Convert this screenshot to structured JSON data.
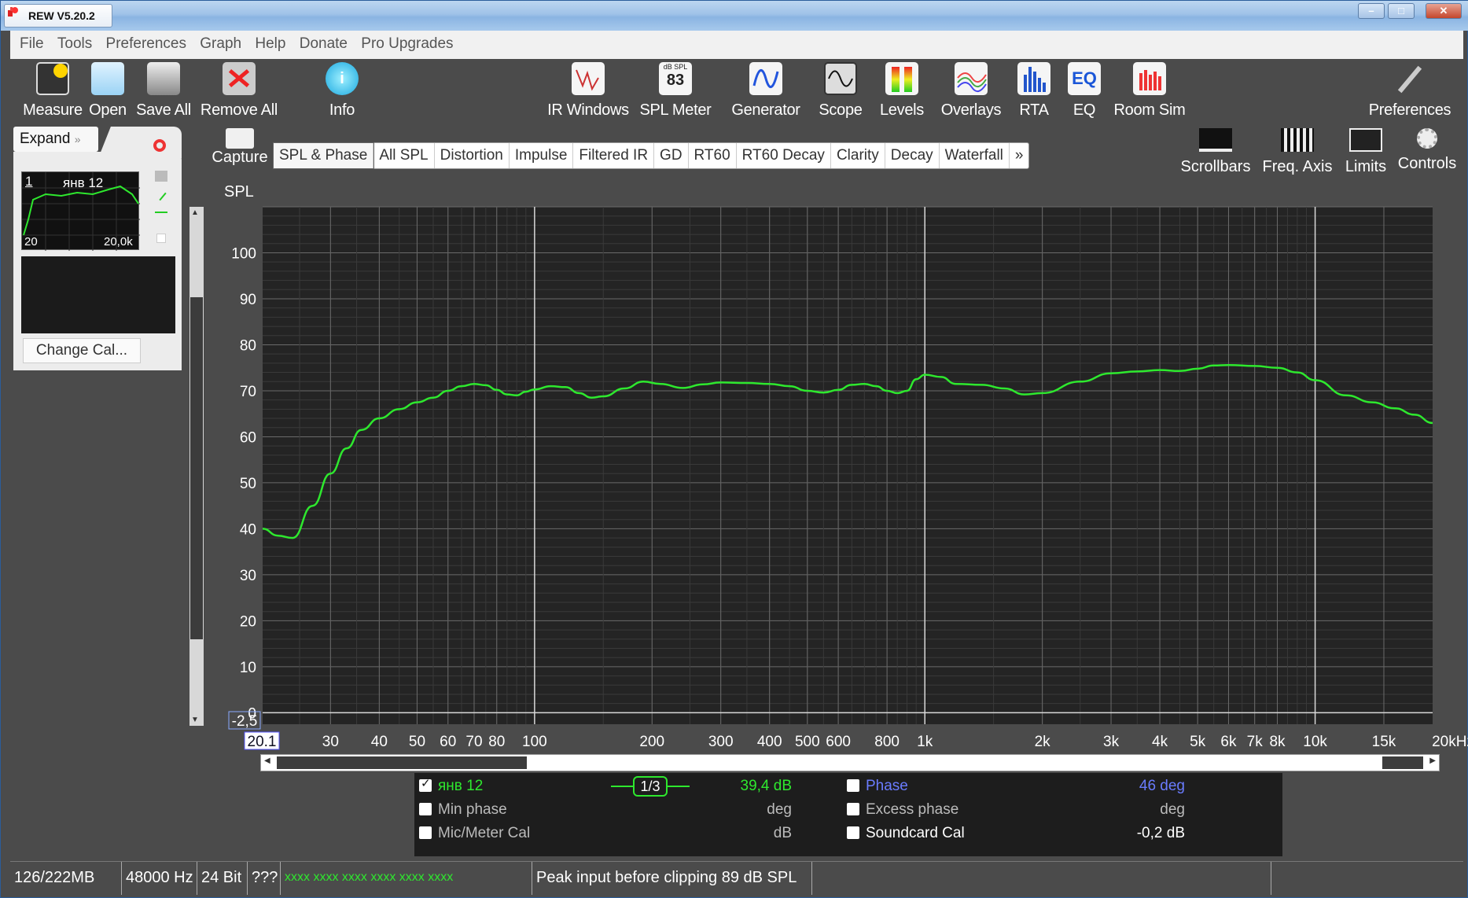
{
  "window": {
    "title": "REW V5.20.2"
  },
  "menu": [
    "File",
    "Tools",
    "Preferences",
    "Graph",
    "Help",
    "Donate",
    "Pro Upgrades"
  ],
  "toolbar": {
    "left": [
      {
        "label": "Measure",
        "icon": "measure-icon"
      },
      {
        "label": "Open",
        "icon": "folder-icon"
      },
      {
        "label": "Save All",
        "icon": "save-icon"
      },
      {
        "label": "Remove All",
        "icon": "remove-icon"
      },
      {
        "label": "Info",
        "icon": "info-icon"
      }
    ],
    "center": [
      {
        "label": "IR Windows",
        "icon": "ir-windows-icon"
      },
      {
        "label": "SPL Meter",
        "icon": "spl-meter-icon",
        "badge_top": "dB SPL",
        "badge_value": "83"
      },
      {
        "label": "Generator",
        "icon": "generator-icon"
      },
      {
        "label": "Scope",
        "icon": "scope-icon"
      },
      {
        "label": "Levels",
        "icon": "levels-icon"
      },
      {
        "label": "Overlays",
        "icon": "overlays-icon"
      },
      {
        "label": "RTA",
        "icon": "rta-icon"
      },
      {
        "label": "EQ",
        "icon": "eq-icon"
      },
      {
        "label": "Room Sim",
        "icon": "room-sim-icon"
      }
    ],
    "preferences": {
      "label": "Preferences",
      "icon": "wrench-icon"
    }
  },
  "left_panel": {
    "expand_label": "Expand",
    "measurement": {
      "index": "1",
      "name": "янв 12",
      "range_start": "20",
      "range_end": "20,0k"
    },
    "change_cal_label": "Change Cal..."
  },
  "graph_tabs": [
    "SPL & Phase",
    "All SPL",
    "Distortion",
    "Impulse",
    "Filtered IR",
    "GD",
    "RT60",
    "RT60 Decay",
    "Clarity",
    "Decay",
    "Waterfall",
    "»"
  ],
  "active_tab": "SPL & Phase",
  "capture_label": "Capture",
  "right_tools": [
    {
      "label": "Scrollbars",
      "icon": "scrollbars-icon"
    },
    {
      "label": "Freq. Axis",
      "icon": "freq-axis-icon"
    },
    {
      "label": "Limits",
      "icon": "limits-icon"
    },
    {
      "label": "Controls",
      "icon": "gear-icon"
    }
  ],
  "chart_data": {
    "type": "line",
    "ylabel": "SPL",
    "y_ticks": [
      "100",
      "90",
      "80",
      "70",
      "60",
      "50",
      "40",
      "30",
      "20",
      "10",
      "0"
    ],
    "ylim": [
      -2.5,
      110
    ],
    "y_min_label": "-2,5",
    "x_scale": "log",
    "xlim": [
      20.1,
      20000
    ],
    "x_min_label": "20.1",
    "x_ticks": [
      {
        "v": 30,
        "t": "30"
      },
      {
        "v": 40,
        "t": "40"
      },
      {
        "v": 50,
        "t": "50"
      },
      {
        "v": 60,
        "t": "60"
      },
      {
        "v": 70,
        "t": "70"
      },
      {
        "v": 80,
        "t": "80"
      },
      {
        "v": 100,
        "t": "100"
      },
      {
        "v": 200,
        "t": "200"
      },
      {
        "v": 300,
        "t": "300"
      },
      {
        "v": 400,
        "t": "400"
      },
      {
        "v": 500,
        "t": "500"
      },
      {
        "v": 600,
        "t": "600"
      },
      {
        "v": 800,
        "t": "800"
      },
      {
        "v": 1000,
        "t": "1k"
      },
      {
        "v": 2000,
        "t": "2k"
      },
      {
        "v": 3000,
        "t": "3k"
      },
      {
        "v": 4000,
        "t": "4k"
      },
      {
        "v": 5000,
        "t": "5k"
      },
      {
        "v": 6000,
        "t": "6k"
      },
      {
        "v": 7000,
        "t": "7k"
      },
      {
        "v": 8000,
        "t": "8k"
      },
      {
        "v": 10000,
        "t": "10k"
      },
      {
        "v": 15000,
        "t": "15k"
      },
      {
        "v": 20000,
        "t": "20kHz"
      }
    ],
    "grid": true,
    "series": [
      {
        "name": "янв 12",
        "color": "#2ee82e",
        "x": [
          20.1,
          22,
          24,
          27,
          30,
          33,
          36,
          40,
          45,
          50,
          55,
          60,
          65,
          70,
          75,
          80,
          85,
          90,
          95,
          100,
          110,
          120,
          130,
          140,
          150,
          170,
          190,
          210,
          240,
          270,
          300,
          350,
          400,
          450,
          500,
          550,
          600,
          650,
          700,
          750,
          800,
          850,
          900,
          950,
          1000,
          1100,
          1200,
          1400,
          1600,
          1800,
          2000,
          2500,
          3000,
          3500,
          4000,
          4500,
          5000,
          5500,
          6000,
          7000,
          8000,
          9000,
          10000,
          12000,
          14000,
          16000,
          18000,
          20000
        ],
        "y": [
          40,
          38.5,
          38,
          45,
          52,
          57.5,
          61.5,
          64,
          66,
          67.5,
          68.5,
          70,
          71,
          71.5,
          71.2,
          70.2,
          69.2,
          69,
          69.8,
          70.3,
          71,
          70.8,
          69.5,
          68.5,
          68.8,
          70.5,
          72,
          71.5,
          70.6,
          71.4,
          71.8,
          71.7,
          71.5,
          71,
          70,
          69.6,
          70.2,
          71.3,
          71.5,
          71,
          70,
          69.5,
          70,
          72.5,
          73.5,
          73,
          71.5,
          71.3,
          70.5,
          69.2,
          69.5,
          72,
          73.8,
          74.2,
          74.5,
          74.3,
          74.8,
          75.5,
          75.6,
          75.4,
          75,
          74,
          72.3,
          69,
          67.5,
          66.2,
          64.8,
          63
        ]
      }
    ]
  },
  "legend": {
    "row1": {
      "name": "янв 12",
      "smoothing": "1/3",
      "value": "39,4 dB",
      "phase_label": "Phase",
      "phase_value": "46 deg"
    },
    "row2": {
      "left_label": "Min phase",
      "left_unit": "deg",
      "right_label": "Excess phase",
      "right_unit": "deg"
    },
    "row3": {
      "left_label": "Mic/Meter Cal",
      "left_unit": "dB",
      "right_label": "Soundcard Cal",
      "right_value": "-0,2 dB"
    }
  },
  "status": {
    "memory": "126/222MB",
    "sample_rate": "48000 Hz",
    "bits": "24 Bit",
    "unknown": "???",
    "meters": "xxxx xxxx xxxx xxxx xxxx xxxx",
    "peak": "Peak input before clipping 89 dB SPL"
  }
}
